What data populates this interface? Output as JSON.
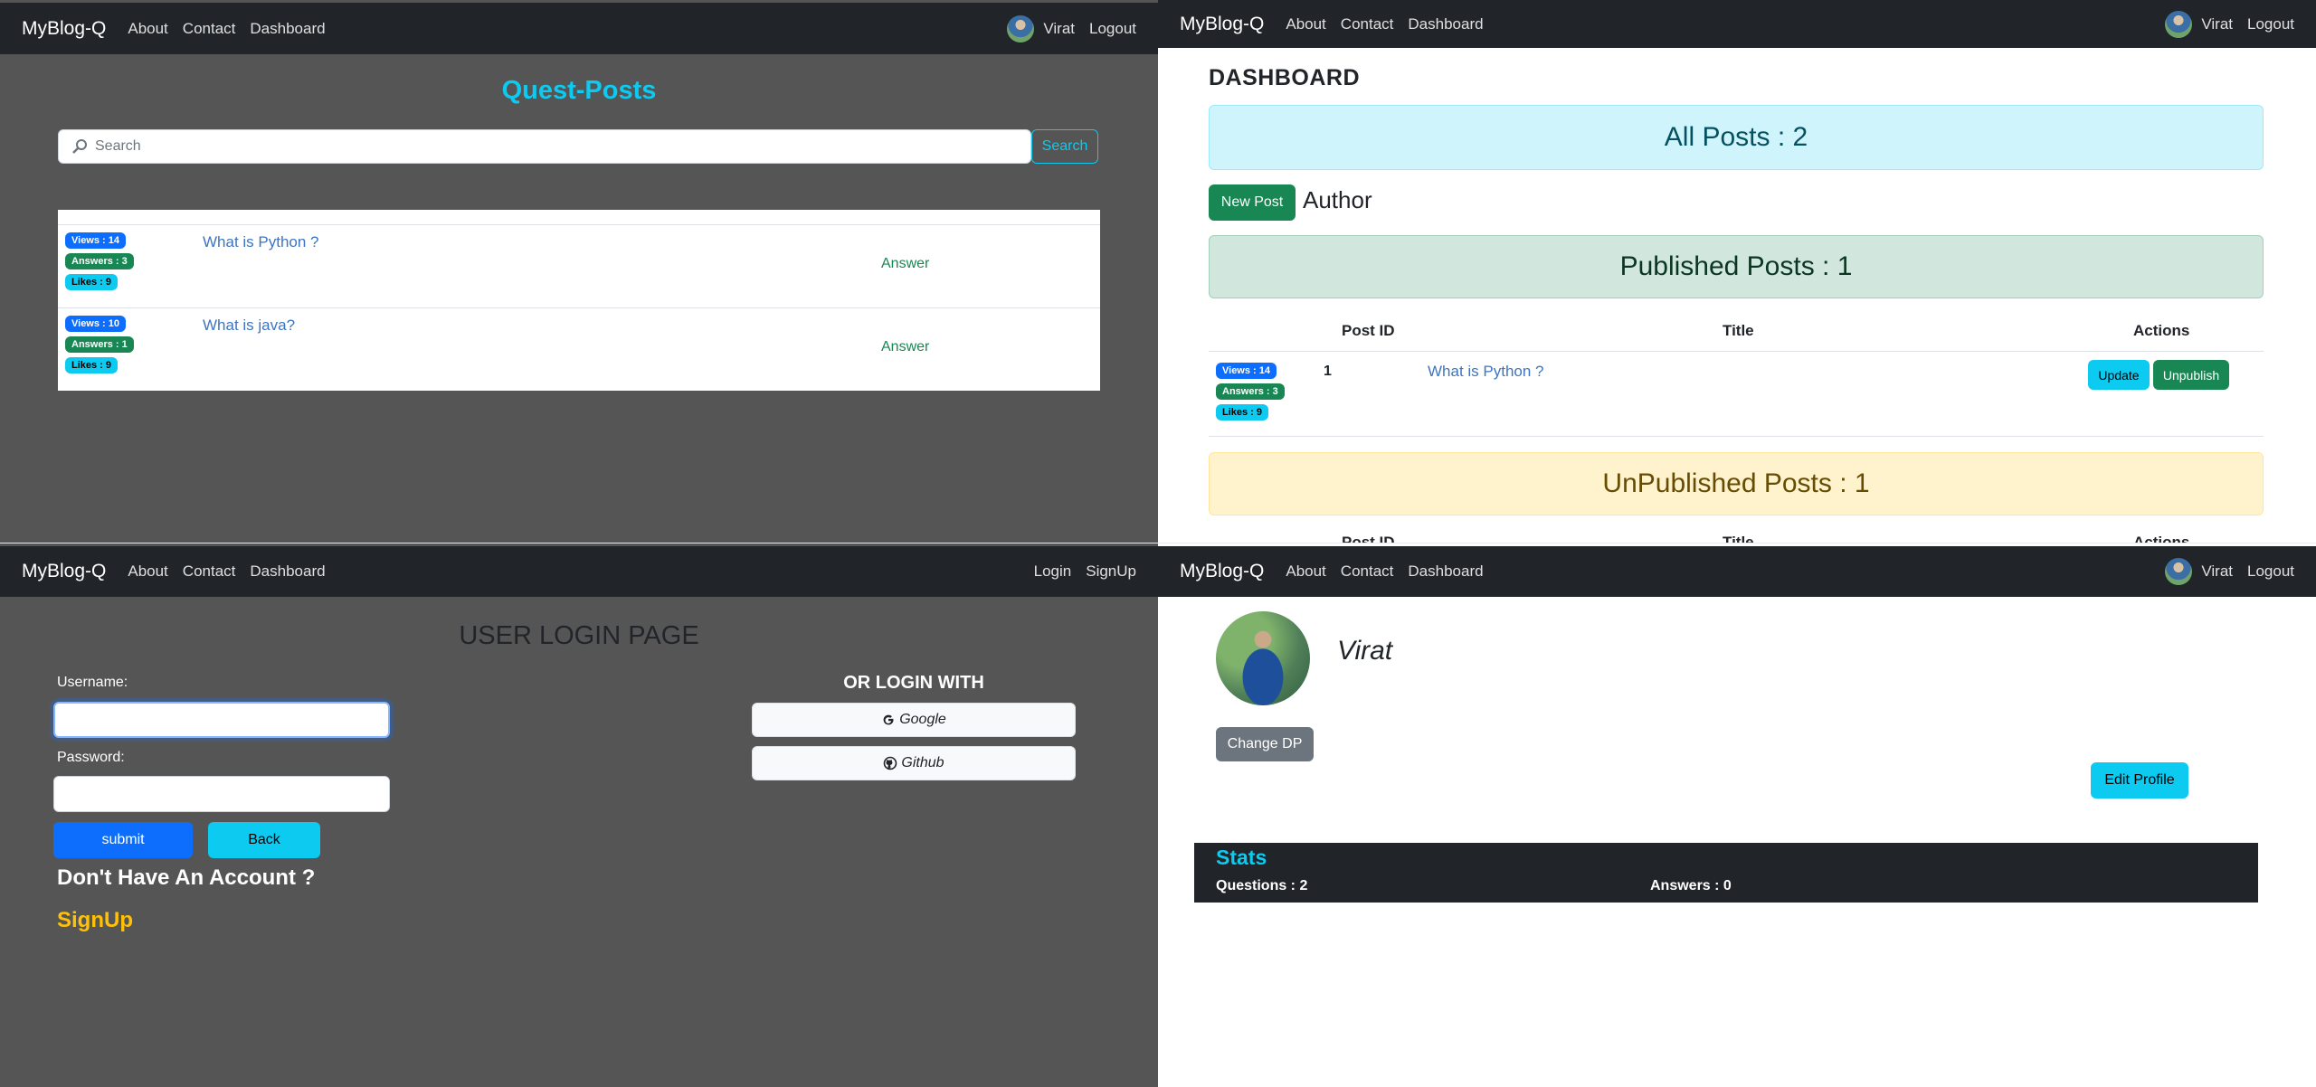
{
  "nav": {
    "brand": "MyBlog-Q",
    "links": [
      "About",
      "Contact",
      "Dashboard"
    ],
    "user_name": "Virat",
    "logout": "Logout",
    "login": "Login",
    "signup": "SignUp"
  },
  "home": {
    "title": "Quest-Posts",
    "search_placeholder": "Search",
    "search_button": "Search",
    "posts": [
      {
        "views": "Views : 14",
        "answers": "Answers : 3",
        "likes": "Likes : 9",
        "title": "What is Python ?",
        "action": "Answer"
      },
      {
        "views": "Views : 10",
        "answers": "Answers : 1",
        "likes": "Likes : 9",
        "title": "What is java?",
        "action": "Answer"
      }
    ]
  },
  "dashboard": {
    "heading": "DASHBOARD",
    "all_posts": "All Posts : 2",
    "new_post_button": "New Post",
    "author_label": "Author",
    "published_posts": "Published Posts : 1",
    "table_headers": {
      "post_id": "Post ID",
      "title": "Title",
      "actions": "Actions"
    },
    "rows": [
      {
        "views": "Views : 14",
        "answers": "Answers : 3",
        "likes": "Likes : 9",
        "id": "1",
        "title": "What is Python ?",
        "update": "Update",
        "unpublish": "Unpublish"
      }
    ],
    "unpublished_posts": "UnPublished Posts : 1"
  },
  "login": {
    "heading": "USER LOGIN PAGE",
    "username_label": "Username:",
    "password_label": "Password:",
    "username_value": "",
    "password_value": "",
    "submit": "submit",
    "back": "Back",
    "no_account": "Don't Have An Account ?",
    "signup": "SignUp",
    "or_login_with": "OR LOGIN WITH",
    "google": "Google",
    "github": "Github"
  },
  "profile": {
    "name": "Virat",
    "change_dp": "Change DP",
    "edit_profile": "Edit Profile",
    "stats_title": "Stats",
    "questions": "Questions : 2",
    "answers": "Answers : 0"
  },
  "colors": {
    "accent": "#0dcaf0",
    "primary": "#0d6efd",
    "success": "#198754",
    "warning": "#ffc107",
    "dark": "#212529",
    "page_bg_dark": "#555555"
  }
}
